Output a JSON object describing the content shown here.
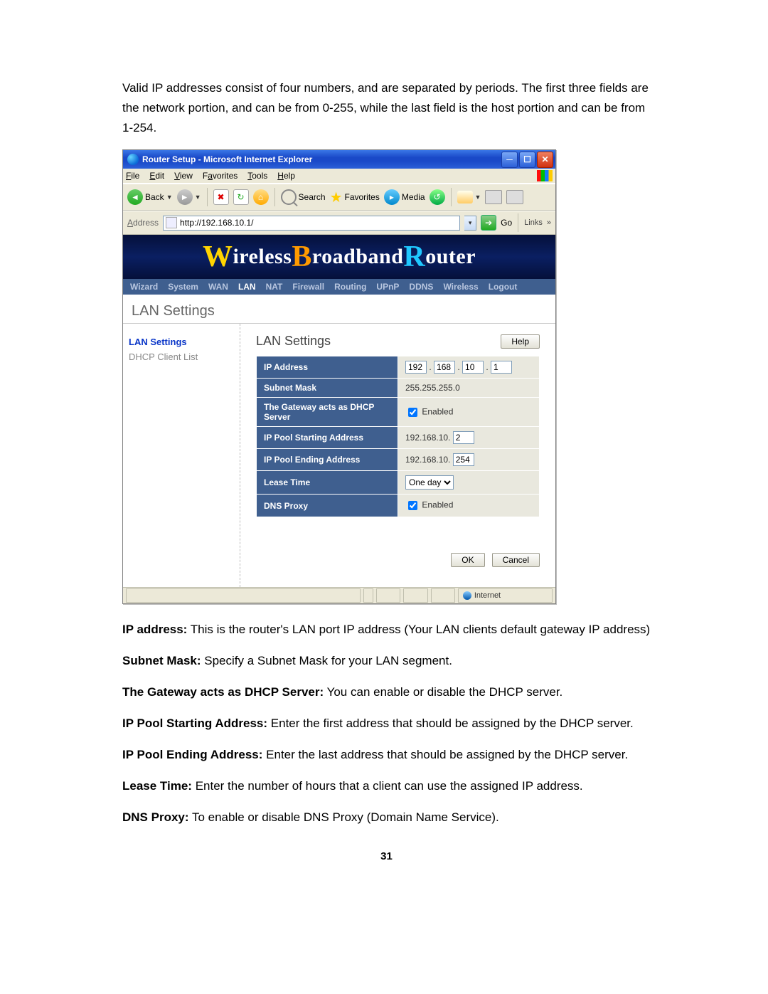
{
  "intro": "Valid IP addresses consist of four numbers, and are separated by periods. The first three fields are the network portion, and can be from 0-255, while the last field is the host portion and can be from 1-254.",
  "window": {
    "title": "Router Setup - Microsoft Internet Explorer",
    "menus": {
      "file": "File",
      "edit": "Edit",
      "view": "View",
      "favorites": "Favorites",
      "tools": "Tools",
      "help": "Help"
    },
    "toolbar": {
      "back": "Back",
      "search": "Search",
      "favorites": "Favorites",
      "media": "Media"
    },
    "address_label": "Address",
    "url": "http://192.168.10.1/",
    "go": "Go",
    "links": "Links",
    "status_zone": "Internet"
  },
  "banner": {
    "w": "W",
    "t1": "ireless ",
    "b": "B",
    "t2": "roadband ",
    "r": "R",
    "t3": "outer"
  },
  "navtabs": [
    "Wizard",
    "System",
    "WAN",
    "LAN",
    "NAT",
    "Firewall",
    "Routing",
    "UPnP",
    "DDNS",
    "Wireless",
    "Logout"
  ],
  "navtabs_active": "LAN",
  "page_heading": "LAN Settings",
  "sidenav": {
    "sel": "LAN Settings",
    "other": "DHCP Client List"
  },
  "main": {
    "heading": "LAN Settings",
    "help": "Help",
    "rows": {
      "ip_label": "IP Address",
      "ip": [
        "192",
        "168",
        "10",
        "1"
      ],
      "subnet_label": "Subnet Mask",
      "subnet": "255.255.255.0",
      "gw_label": "The Gateway acts as DHCP Server",
      "enabled": "Enabled",
      "start_label": "IP Pool Starting Address",
      "pool_prefix": "192.168.10.",
      "start": "2",
      "end_label": "IP Pool Ending Address",
      "end": "254",
      "lease_label": "Lease Time",
      "lease": "One day",
      "dns_label": "DNS Proxy"
    },
    "ok": "OK",
    "cancel": "Cancel"
  },
  "defs": {
    "ip_b": "IP address:",
    "ip_t": " This is the router's LAN port IP address (Your LAN clients default gateway IP address)",
    "sm_b": "Subnet Mask:",
    "sm_t": " Specify a Subnet Mask for your LAN segment.",
    "gw_b": "The Gateway acts as DHCP Server:",
    "gw_t": " You can enable or disable the DHCP server.",
    "ps_b": "IP Pool Starting Address:",
    "ps_t": " Enter the first address that should be assigned by the DHCP server.",
    "pe_b": "IP Pool Ending Address:",
    "pe_t": " Enter the last address that should be assigned by the DHCP server.",
    "lt_b": "Lease Time:",
    "lt_t": " Enter the number of hours that a client can use the assigned IP address.",
    "dp_b": "DNS Proxy:",
    "dp_t": " To enable or disable DNS Proxy (Domain Name Service)."
  },
  "page_number": "31"
}
